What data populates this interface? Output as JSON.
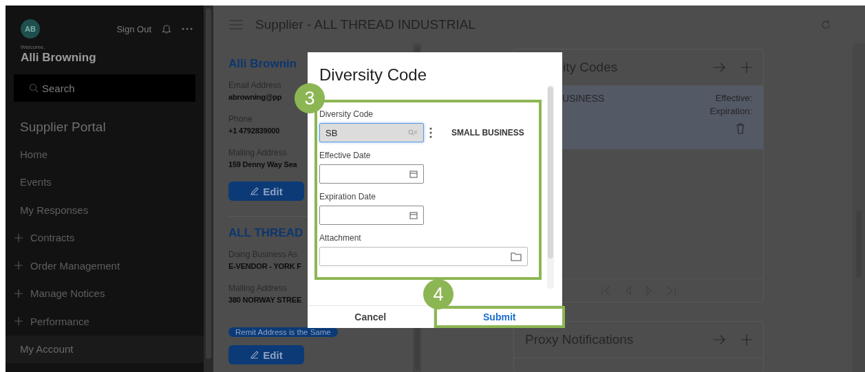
{
  "sidebar": {
    "avatar": "AB",
    "sign_out": "Sign Out",
    "welcome": "Welcome,",
    "user": "Alli Browning",
    "search": {
      "placeholder": "Search"
    },
    "portal_title": "Supplier Portal",
    "items": [
      {
        "label": "Home",
        "expandable": false,
        "selected": false
      },
      {
        "label": "Events",
        "expandable": false,
        "selected": false
      },
      {
        "label": "My Responses",
        "expandable": false,
        "selected": false
      },
      {
        "label": "Contracts",
        "expandable": true,
        "selected": false
      },
      {
        "label": "Order Management",
        "expandable": true,
        "selected": false
      },
      {
        "label": "Manage Notices",
        "expandable": true,
        "selected": false
      },
      {
        "label": "Performance",
        "expandable": true,
        "selected": false
      },
      {
        "label": "My Account",
        "expandable": false,
        "selected": true
      }
    ]
  },
  "header": {
    "title": "Supplier - ALL THREAD INDUSTRIAL"
  },
  "contact": {
    "name": "Alli Brownin",
    "fields": [
      {
        "label": "Email Address",
        "value": "abrowning@pp"
      },
      {
        "label": "Phone",
        "value": "+1 4792839000"
      },
      {
        "label": "Mailing Address",
        "value": "159 Denny Way Sea"
      }
    ],
    "edit": "Edit"
  },
  "company": {
    "name": "ALL THREAD",
    "fields": [
      {
        "label": "Doing Business As",
        "value": "E-VENDOR - YORK F"
      },
      {
        "label": "Mailing Address",
        "value": "380 NORWAY STREE"
      }
    ],
    "badge": "Remit Address is the Same",
    "edit": "Edit"
  },
  "diversity_panel": {
    "title": "ity Codes",
    "rows": [
      {
        "code": "USINESS",
        "effective": "Effective:",
        "expiration": "Expiration:",
        "selected": true
      }
    ]
  },
  "proxy_panel": {
    "title": "Proxy Notifications"
  },
  "dialog": {
    "title": "Diversity Code",
    "callout": "3",
    "fields": [
      {
        "label": "Diversity Code",
        "kind": "lookup",
        "value": "SB",
        "focused": true,
        "description": "SMALL BUSINESS"
      },
      {
        "label": "Effective Date",
        "kind": "date"
      },
      {
        "label": "Expiration Date",
        "kind": "date"
      },
      {
        "label": "Attachment",
        "kind": "file"
      }
    ],
    "buttons": [
      {
        "label": "Cancel",
        "kind": "secondary"
      },
      {
        "label": "Submit",
        "kind": "primary",
        "callout": "4"
      }
    ]
  }
}
